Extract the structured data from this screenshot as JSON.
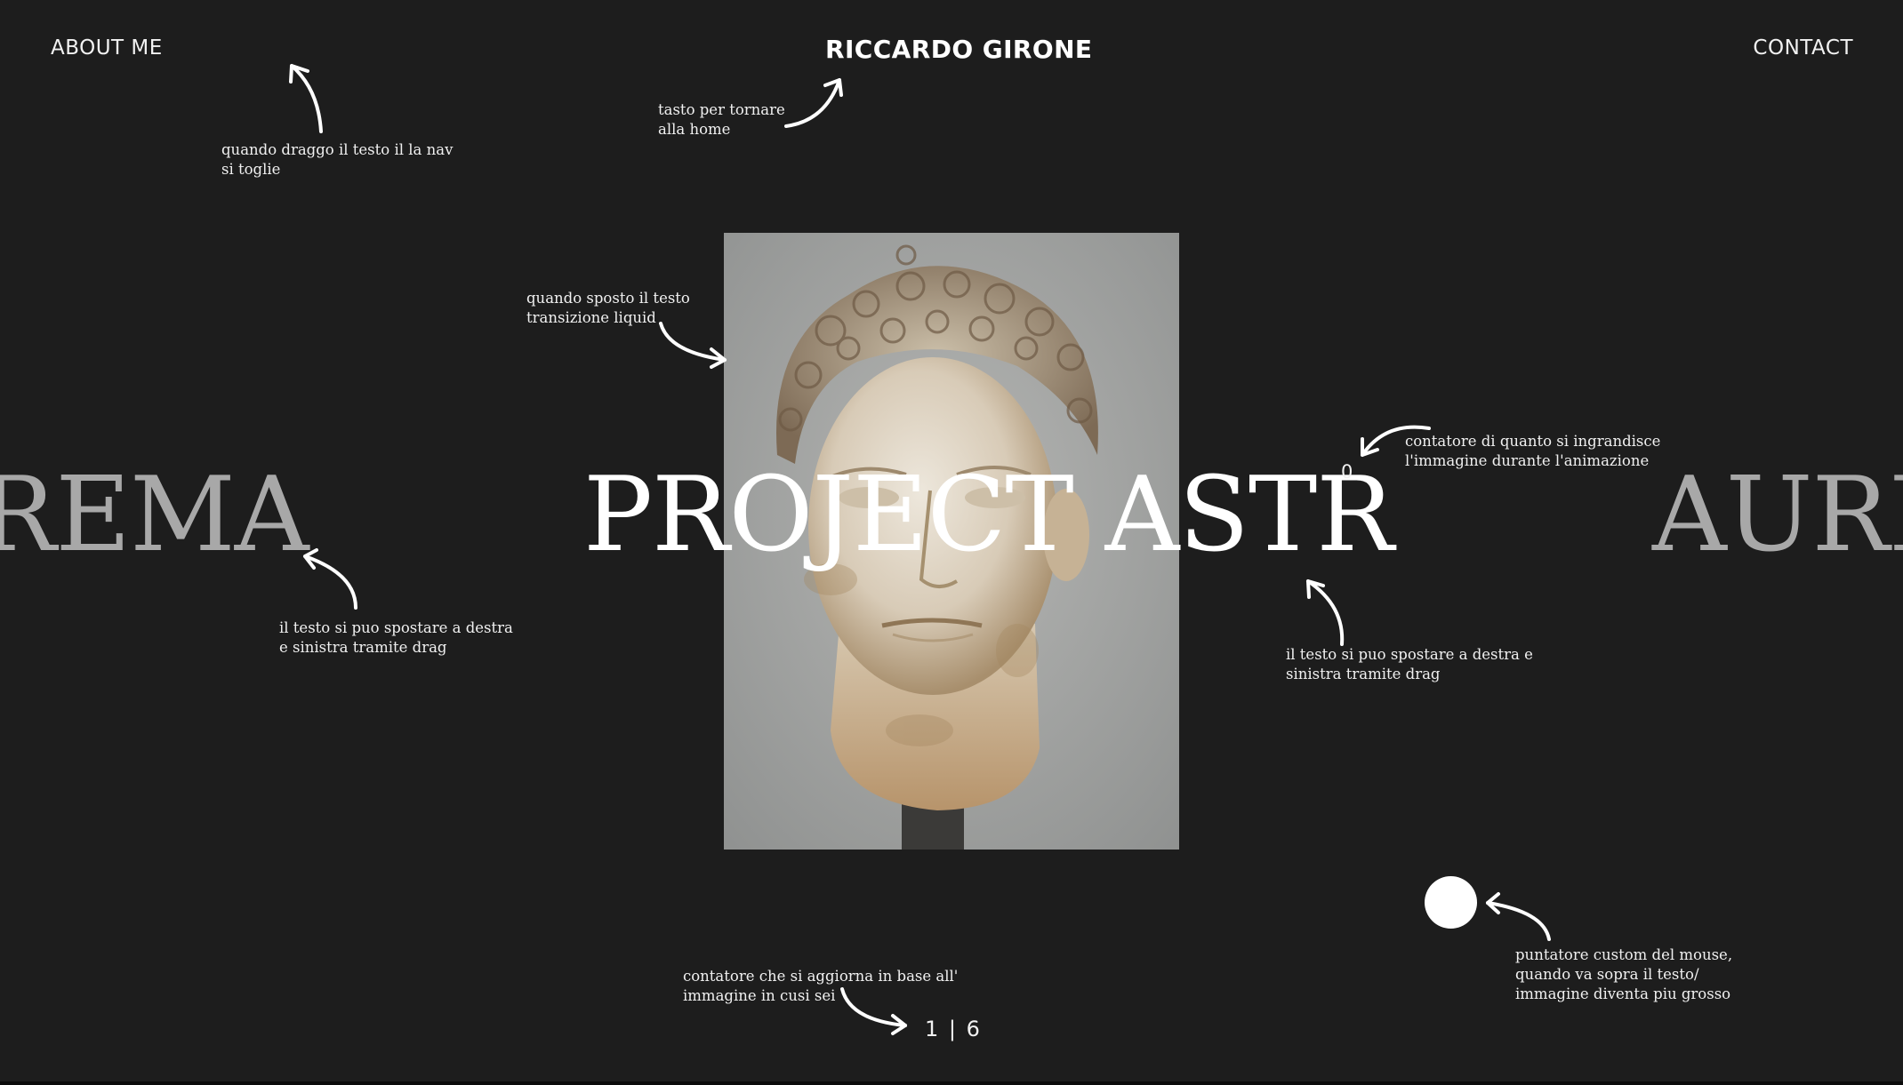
{
  "nav": {
    "about_label": "ABOUT ME",
    "brand_label": "RICCARDO GIRONE",
    "contact_label": "CONTACT"
  },
  "slider": {
    "title_left": "REMA",
    "title_center": "PROJECT ASTR",
    "title_right": "AURI",
    "zoom_counter": "0",
    "current_slide": "1",
    "separator": "|",
    "total_slides": "6"
  },
  "annotations": {
    "nav_hide": [
      "quando draggo il testo il la nav",
      "si toglie"
    ],
    "home_button": [
      "tasto per tornare",
      "alla home"
    ],
    "liquid_transition": [
      "quando sposto il testo",
      "transizione liquid"
    ],
    "zoom_counter": [
      "contatore di quanto si ingrandisce",
      "l'immagine durante l'animazione"
    ],
    "drag_left": [
      "il testo si puo spostare a destra",
      "e sinistra tramite drag"
    ],
    "drag_right": [
      "il testo si puo spostare a destra e",
      "sinistra tramite drag"
    ],
    "slide_counter": [
      "contatore che si aggiorna in base all'",
      "immagine in cusi sei"
    ],
    "custom_cursor": [
      "puntatore custom del mouse,",
      "quando va sopra il testo/",
      "immagine diventa piu grosso"
    ]
  },
  "colors": {
    "background": "#1d1d1d",
    "text": "#ffffff",
    "inactive_title": "#a8a8a8"
  }
}
